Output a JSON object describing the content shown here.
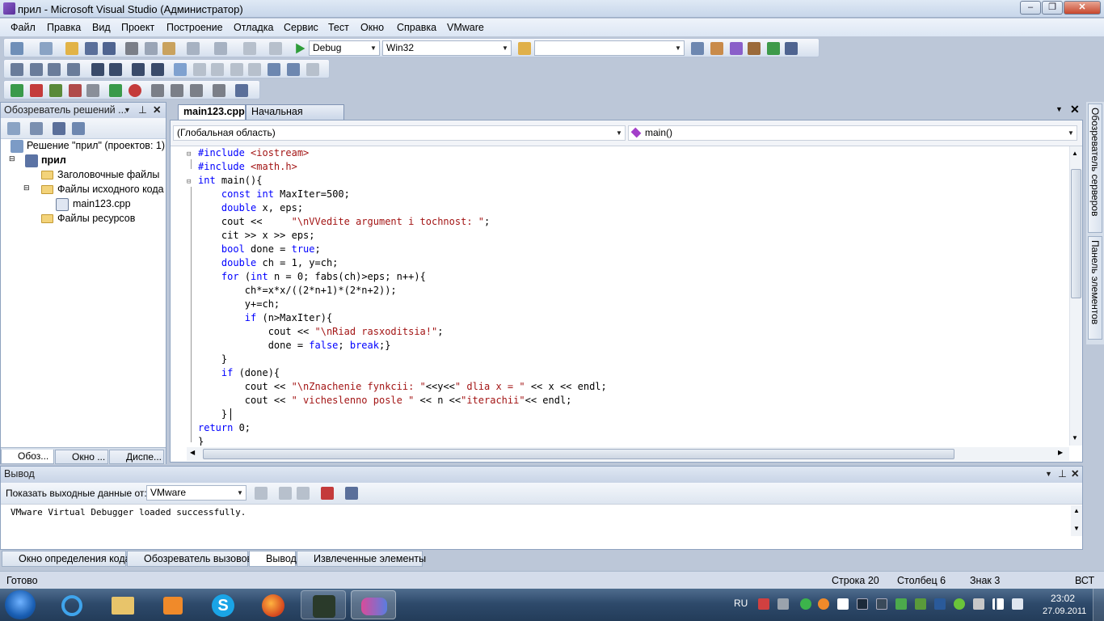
{
  "window": {
    "title": "прил - Microsoft Visual Studio (Администратор)",
    "minimize": "–",
    "restore": "❐",
    "close": "✕"
  },
  "menu": [
    "Файл",
    "Правка",
    "Вид",
    "Проект",
    "Построение",
    "Отладка",
    "Сервис",
    "Тест",
    "Окно",
    "Справка",
    "VMware"
  ],
  "toolbar": {
    "config": "Debug",
    "platform": "Win32",
    "find_value": ""
  },
  "solution_explorer": {
    "title": "Обозреватель решений ...",
    "solution": "Решение \"прил\"  (проектов: 1)",
    "project": "прил",
    "headers": "Заголовочные файлы",
    "sources": "Файлы исходного кода",
    "source_file": "main123.cpp",
    "resources": "Файлы ресурсов",
    "tabs": [
      "Обоз...",
      "Окно ...",
      "Диспе..."
    ]
  },
  "editor": {
    "tabs": [
      "main123.cpp",
      "Начальная страница"
    ],
    "scope": "(Глобальная область)",
    "member": "main()",
    "code": [
      [
        {
          "t": "#include ",
          "c": "pp"
        },
        {
          "t": "<iostream>",
          "c": "st"
        }
      ],
      [
        {
          "t": "#include ",
          "c": "pp"
        },
        {
          "t": "<math.h>",
          "c": "st"
        }
      ],
      [
        {
          "t": "int",
          "c": "kw"
        },
        {
          "t": " main(){",
          "c": ""
        }
      ],
      [
        {
          "t": "    ",
          "c": ""
        },
        {
          "t": "const",
          "c": "kw"
        },
        {
          "t": " ",
          "c": ""
        },
        {
          "t": "int",
          "c": "kw"
        },
        {
          "t": " MaxIter=500;",
          "c": ""
        }
      ],
      [
        {
          "t": "    ",
          "c": ""
        },
        {
          "t": "double",
          "c": "kw"
        },
        {
          "t": " x, eps;",
          "c": ""
        }
      ],
      [
        {
          "t": "    cout <<     ",
          "c": ""
        },
        {
          "t": "\"\\nVVedite argument i tochnost: \"",
          "c": "st"
        },
        {
          "t": ";",
          "c": ""
        }
      ],
      [
        {
          "t": "    cit >> x >> eps;",
          "c": ""
        }
      ],
      [
        {
          "t": "    ",
          "c": ""
        },
        {
          "t": "bool",
          "c": "kw"
        },
        {
          "t": " done = ",
          "c": ""
        },
        {
          "t": "true",
          "c": "kw"
        },
        {
          "t": ";",
          "c": ""
        }
      ],
      [
        {
          "t": "    ",
          "c": ""
        },
        {
          "t": "double",
          "c": "kw"
        },
        {
          "t": " ch = 1, y=ch;",
          "c": ""
        }
      ],
      [
        {
          "t": "    ",
          "c": ""
        },
        {
          "t": "for",
          "c": "kw"
        },
        {
          "t": " (",
          "c": ""
        },
        {
          "t": "int",
          "c": "kw"
        },
        {
          "t": " n = 0; fabs(ch)>eps; n++){",
          "c": ""
        }
      ],
      [
        {
          "t": "        ch*=x*x/((2*n+1)*(2*n+2));",
          "c": ""
        }
      ],
      [
        {
          "t": "        y+=ch;",
          "c": ""
        }
      ],
      [
        {
          "t": "        ",
          "c": ""
        },
        {
          "t": "if",
          "c": "kw"
        },
        {
          "t": " (n>MaxIter){",
          "c": ""
        }
      ],
      [
        {
          "t": "            cout << ",
          "c": ""
        },
        {
          "t": "\"\\nRiad rasxoditsia!\"",
          "c": "st"
        },
        {
          "t": ";",
          "c": ""
        }
      ],
      [
        {
          "t": "            done = ",
          "c": ""
        },
        {
          "t": "false",
          "c": "kw"
        },
        {
          "t": "; ",
          "c": ""
        },
        {
          "t": "break",
          "c": "kw"
        },
        {
          "t": ";}",
          "c": ""
        }
      ],
      [
        {
          "t": "    }",
          "c": ""
        }
      ],
      [
        {
          "t": "    ",
          "c": ""
        },
        {
          "t": "if",
          "c": "kw"
        },
        {
          "t": " (done){",
          "c": ""
        }
      ],
      [
        {
          "t": "        cout << ",
          "c": ""
        },
        {
          "t": "\"\\nZnachenie fynkcii: \"",
          "c": "st"
        },
        {
          "t": "<<y<<",
          "c": ""
        },
        {
          "t": "\" dlia x = \"",
          "c": "st"
        },
        {
          "t": " << x << endl;",
          "c": ""
        }
      ],
      [
        {
          "t": "        cout << ",
          "c": ""
        },
        {
          "t": "\" vicheslenno posle \"",
          "c": "st"
        },
        {
          "t": " << n <<",
          "c": ""
        },
        {
          "t": "\"iterachii\"",
          "c": "st"
        },
        {
          "t": "<< endl;",
          "c": ""
        }
      ],
      [
        {
          "t": "    }",
          "c": ""
        }
      ],
      [
        {
          "t": "return",
          "c": "kw"
        },
        {
          "t": " 0;",
          "c": ""
        }
      ],
      [
        {
          "t": "}",
          "c": ""
        }
      ]
    ]
  },
  "output": {
    "title": "Вывод",
    "show_from_label": "Показать выходные данные от:",
    "source": "VMware",
    "text": "VMware Virtual Debugger loaded successfully."
  },
  "bottom_tabs": [
    "Окно определения кода",
    "Обозреватель вызовов",
    "Вывод",
    "Извлеченные элементы"
  ],
  "right_tabs": [
    "Обозреватель серверов",
    "Панель элементов"
  ],
  "status": {
    "ready": "Готово",
    "line": "Строка 20",
    "col": "Столбец 6",
    "char": "Знак 3",
    "mode": "ВСТ"
  },
  "taskbar": {
    "lang": "RU",
    "time": "23:02",
    "date": "27.09.2011"
  }
}
